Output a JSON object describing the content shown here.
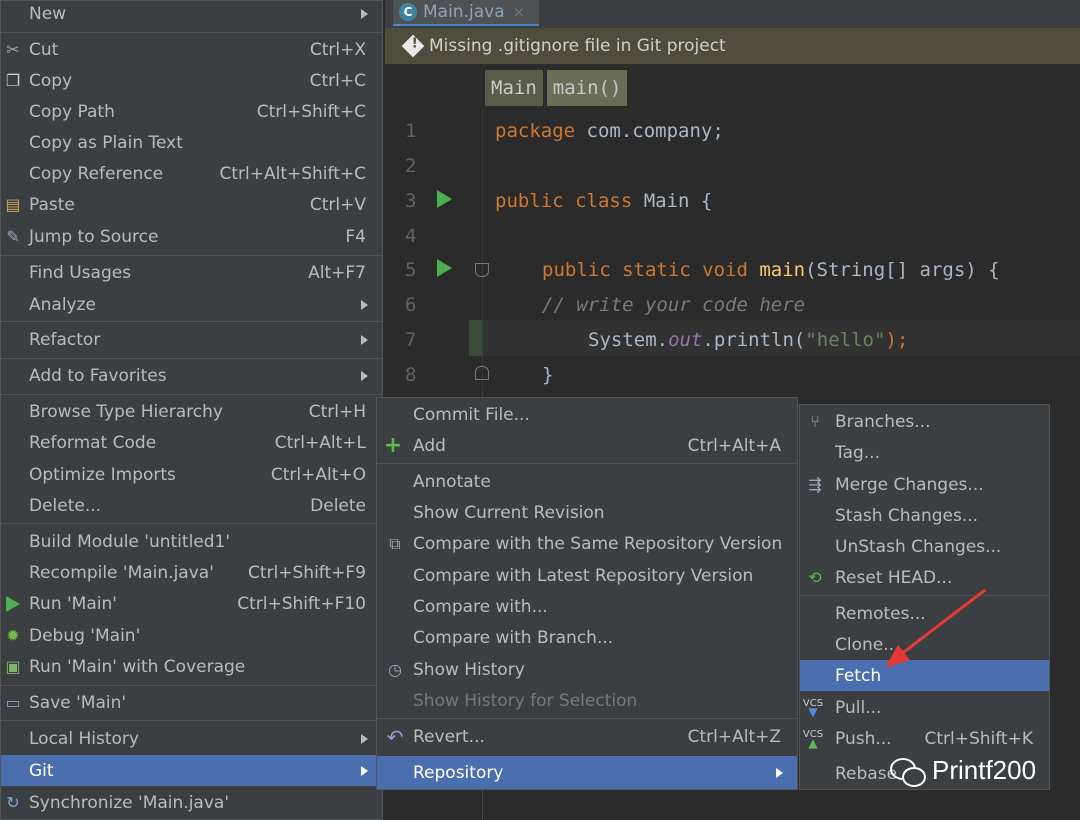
{
  "editor": {
    "tab_label": "Main.java",
    "tab_close": "×",
    "banner": "Missing .gitignore file in Git project",
    "breadcrumbs": [
      "Main",
      "main()"
    ],
    "line_numbers": [
      "1",
      "2",
      "3",
      "4",
      "5",
      "6",
      "7",
      "8"
    ],
    "code": {
      "l1_kw": "package",
      "l1_rest": " com.company;",
      "l3_kw": "public class",
      "l3_rest": " Main {",
      "l5_kw": "public static void",
      "l5_fn": " main",
      "l5_rest": "(String[] args) {",
      "l6": "// write your code here",
      "l7_a": "System.",
      "l7_fld": "out",
      "l7_b": ".println(",
      "l7_str": "\"hello\"",
      "l7_c": ");",
      "l8": "}"
    }
  },
  "context_menu": {
    "items": [
      {
        "label": "New",
        "shortcut": ""
      },
      {
        "label": "Cut",
        "shortcut": "Ctrl+X"
      },
      {
        "label": "Copy",
        "shortcut": "Ctrl+C"
      },
      {
        "label": "Copy Path",
        "shortcut": "Ctrl+Shift+C"
      },
      {
        "label": "Copy as Plain Text",
        "shortcut": ""
      },
      {
        "label": "Copy Reference",
        "shortcut": "Ctrl+Alt+Shift+C"
      },
      {
        "label": "Paste",
        "shortcut": "Ctrl+V"
      },
      {
        "label": "Jump to Source",
        "shortcut": "F4"
      },
      {
        "label": "Find Usages",
        "shortcut": "Alt+F7"
      },
      {
        "label": "Analyze",
        "shortcut": ""
      },
      {
        "label": "Refactor",
        "shortcut": ""
      },
      {
        "label": "Add to Favorites",
        "shortcut": ""
      },
      {
        "label": "Browse Type Hierarchy",
        "shortcut": "Ctrl+H"
      },
      {
        "label": "Reformat Code",
        "shortcut": "Ctrl+Alt+L"
      },
      {
        "label": "Optimize Imports",
        "shortcut": "Ctrl+Alt+O"
      },
      {
        "label": "Delete...",
        "shortcut": "Delete"
      },
      {
        "label": "Build Module 'untitled1'",
        "shortcut": ""
      },
      {
        "label": "Recompile 'Main.java'",
        "shortcut": "Ctrl+Shift+F9"
      },
      {
        "label": "Run 'Main'",
        "shortcut": "Ctrl+Shift+F10"
      },
      {
        "label": "Debug 'Main'",
        "shortcut": ""
      },
      {
        "label": "Run 'Main' with Coverage",
        "shortcut": ""
      },
      {
        "label": "Save 'Main'",
        "shortcut": ""
      },
      {
        "label": "Local History",
        "shortcut": ""
      },
      {
        "label": "Git",
        "shortcut": ""
      },
      {
        "label": "Synchronize 'Main.java'",
        "shortcut": ""
      }
    ]
  },
  "git_menu": {
    "items": [
      {
        "label": "Commit File...",
        "shortcut": ""
      },
      {
        "label": "Add",
        "shortcut": "Ctrl+Alt+A"
      },
      {
        "label": "Annotate",
        "shortcut": ""
      },
      {
        "label": "Show Current Revision",
        "shortcut": ""
      },
      {
        "label": "Compare with the Same Repository Version",
        "shortcut": ""
      },
      {
        "label": "Compare with Latest Repository Version",
        "shortcut": ""
      },
      {
        "label": "Compare with...",
        "shortcut": ""
      },
      {
        "label": "Compare with Branch...",
        "shortcut": ""
      },
      {
        "label": "Show History",
        "shortcut": ""
      },
      {
        "label": "Show History for Selection",
        "shortcut": ""
      },
      {
        "label": "Revert...",
        "shortcut": "Ctrl+Alt+Z"
      },
      {
        "label": "Repository",
        "shortcut": ""
      }
    ]
  },
  "repository_menu": {
    "items": [
      {
        "label": "Branches...",
        "shortcut": ""
      },
      {
        "label": "Tag...",
        "shortcut": ""
      },
      {
        "label": "Merge Changes...",
        "shortcut": ""
      },
      {
        "label": "Stash Changes...",
        "shortcut": ""
      },
      {
        "label": "UnStash Changes...",
        "shortcut": ""
      },
      {
        "label": "Reset HEAD...",
        "shortcut": ""
      },
      {
        "label": "Remotes...",
        "shortcut": ""
      },
      {
        "label": "Clone...",
        "shortcut": ""
      },
      {
        "label": "Fetch",
        "shortcut": ""
      },
      {
        "label": "Pull...",
        "shortcut": ""
      },
      {
        "label": "Push...",
        "shortcut": "Ctrl+Shift+K"
      },
      {
        "label": "Rebase",
        "shortcut": ""
      }
    ]
  },
  "icons": {
    "vcs_badge": "VCS"
  },
  "watermark": "Printf200",
  "colors": {
    "selection": "#4b6eaf",
    "menu_bg": "#3c3f41",
    "annotation_arrow": "#e53935"
  }
}
